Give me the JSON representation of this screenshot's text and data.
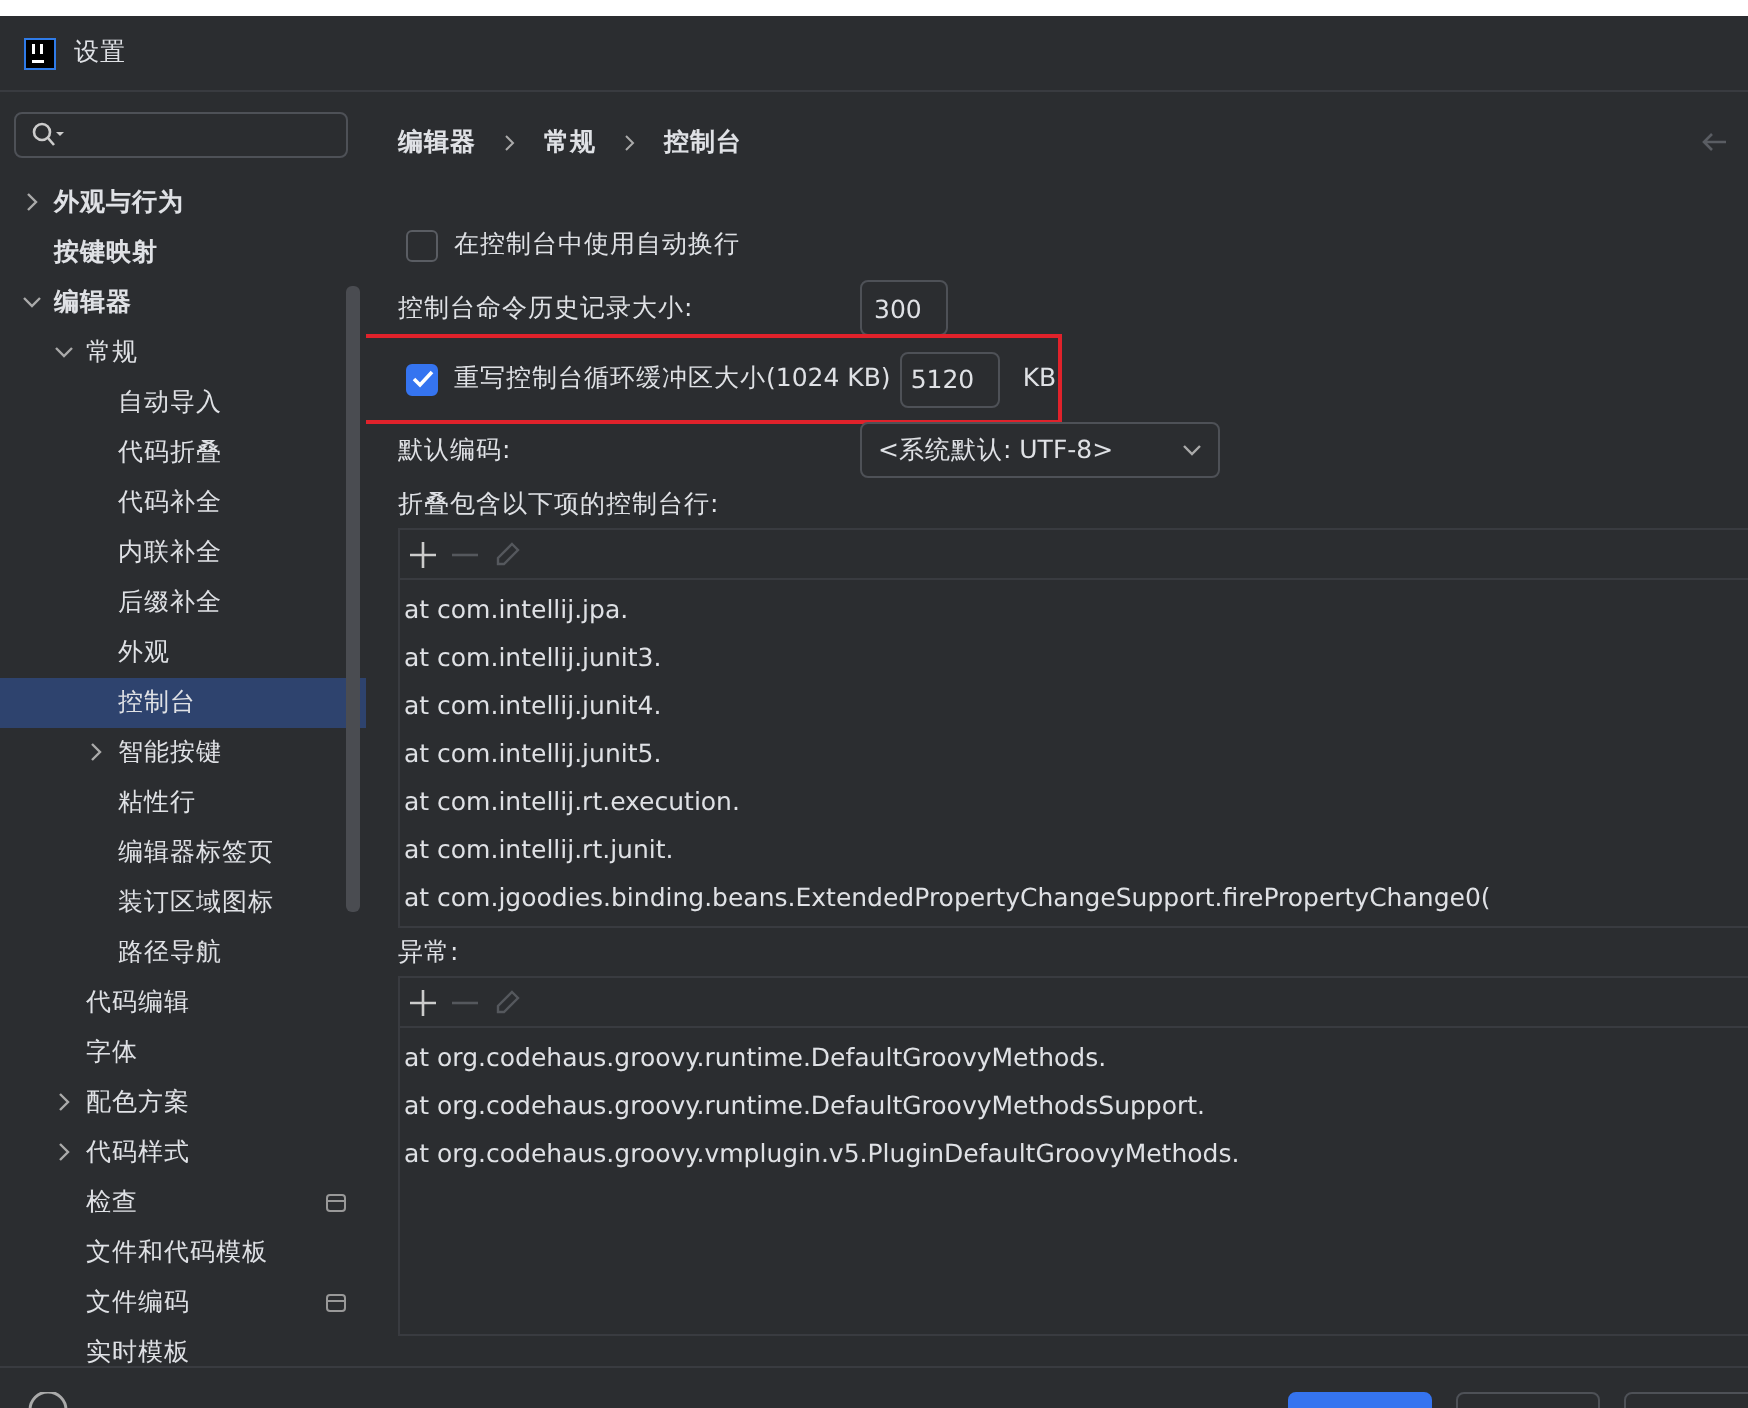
{
  "window": {
    "title": "设置"
  },
  "sidebar": {
    "items": [
      {
        "label": "外观与行为",
        "bold": true,
        "expanded": false
      },
      {
        "label": "按键映射",
        "bold": true
      },
      {
        "label": "编辑器",
        "bold": true,
        "expanded": true,
        "children": [
          {
            "label": "常规",
            "expanded": true,
            "children": [
              {
                "label": "自动导入",
                "selected": false
              },
              {
                "label": "代码折叠",
                "selected": false
              },
              {
                "label": "代码补全",
                "selected": false
              },
              {
                "label": "内联补全",
                "selected": false
              },
              {
                "label": "后缀补全",
                "selected": false
              },
              {
                "label": "外观",
                "selected": false
              },
              {
                "label": "控制台",
                "selected": true
              },
              {
                "label": "智能按键",
                "selected": false,
                "expanded": false
              },
              {
                "label": "粘性行",
                "selected": false
              },
              {
                "label": "编辑器标签页",
                "selected": false
              },
              {
                "label": "装订区域图标",
                "selected": false
              },
              {
                "label": "路径导航",
                "selected": false
              }
            ]
          },
          {
            "label": "代码编辑",
            "project_scope": false
          },
          {
            "label": "字体",
            "project_scope": false
          },
          {
            "label": "配色方案",
            "expanded": false,
            "project_scope": false
          },
          {
            "label": "代码样式",
            "expanded": false,
            "project_scope": false
          },
          {
            "label": "检查",
            "project_scope": true
          },
          {
            "label": "文件和代码模板",
            "project_scope": false
          },
          {
            "label": "文件编码",
            "project_scope": true
          },
          {
            "label": "实时模板",
            "project_scope": false
          }
        ]
      }
    ]
  },
  "breadcrumb": [
    "编辑器",
    "常规",
    "控制台"
  ],
  "settings": [
    {
      "kind": "checkbox",
      "label": "在控制台中使用自动换行",
      "checked": false
    },
    {
      "kind": "number",
      "label": "控制台命令历史记录大小:",
      "value": "300"
    },
    {
      "kind": "checkbox-number",
      "label": "重写控制台循环缓冲区大小(1024 KB)",
      "checked": true,
      "value": "5120",
      "unit": "KB",
      "highlighted": true
    },
    {
      "kind": "select",
      "label": "默认编码:",
      "value": "<系统默认: UTF-8>"
    }
  ],
  "lists": [
    {
      "title": "折叠包含以下项的控制台行:",
      "rows": [
        "at com.intellij.jpa.",
        "at com.intellij.junit3.",
        "at com.intellij.junit4.",
        "at com.intellij.junit5.",
        "at com.intellij.rt.execution.",
        "at com.intellij.rt.junit.",
        "at com.jgoodies.binding.beans.ExtendedPropertyChangeSupport.firePropertyChange0("
      ]
    },
    {
      "title": "异常:",
      "rows": [
        "at org.codehaus.groovy.runtime.DefaultGroovyMethods.",
        "at org.codehaus.groovy.runtime.DefaultGroovyMethodsSupport.",
        "at org.codehaus.groovy.vmplugin.v5.PluginDefaultGroovyMethods."
      ]
    }
  ]
}
